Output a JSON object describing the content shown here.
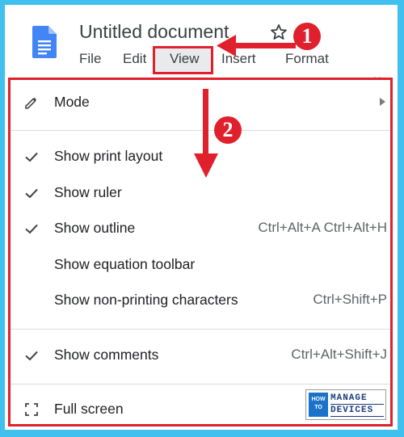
{
  "header": {
    "title": "Untitled document",
    "star_icon": "star-outline-icon",
    "app_icon": "google-docs-icon"
  },
  "menubar": {
    "items": [
      {
        "label": "File"
      },
      {
        "label": "Edit"
      },
      {
        "label": "View"
      },
      {
        "label": "Insert"
      },
      {
        "label": "Format"
      }
    ],
    "overflow": ".."
  },
  "view_menu": {
    "items": [
      {
        "label": "Mode",
        "icon": "pencil-icon",
        "has_submenu": true
      },
      {
        "label": "Show print layout",
        "checked": true
      },
      {
        "label": "Show ruler",
        "checked": true
      },
      {
        "label": "Show outline",
        "checked": true,
        "shortcut": "Ctrl+Alt+A Ctrl+Alt+H"
      },
      {
        "label": "Show equation toolbar",
        "checked": false
      },
      {
        "label": "Show non-printing characters",
        "checked": false,
        "shortcut": "Ctrl+Shift+P"
      },
      {
        "label": "Show comments",
        "checked": true,
        "shortcut": "Ctrl+Alt+Shift+J"
      },
      {
        "label": "Full screen",
        "icon": "fullscreen-icon"
      }
    ]
  },
  "annotations": {
    "marker_1": "1",
    "marker_2": "2",
    "accent_color": "#e0202d"
  },
  "watermark": {
    "left_top": "HOW",
    "left_bottom": "TO",
    "right_top": "MANAGE",
    "right_bottom": "DEVICES"
  },
  "colors": {
    "background": "#3fc0ee",
    "docs_blue": "#4285f4",
    "highlight_border": "#e0202d"
  }
}
